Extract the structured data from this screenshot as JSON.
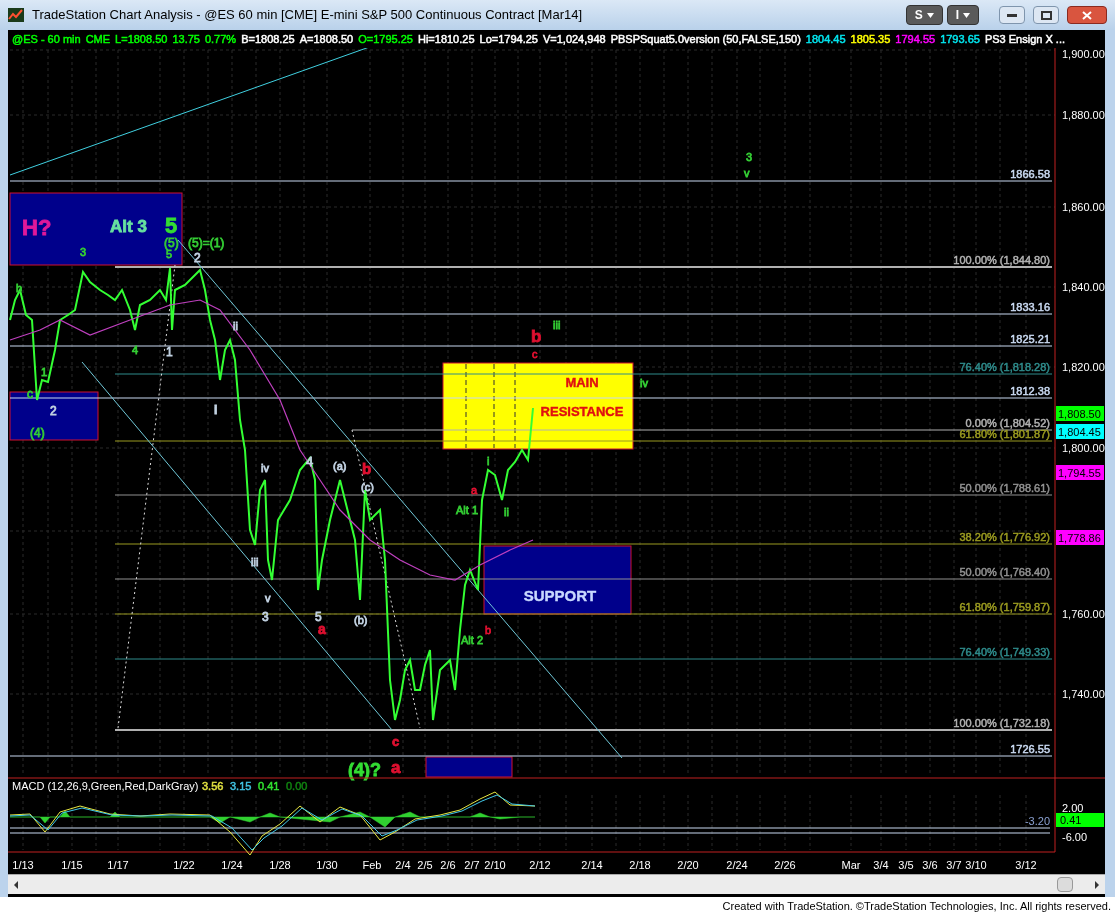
{
  "window": {
    "title": "TradeStation Chart Analysis - @ES 60 min [CME] E-mini S&P 500 Continuous Contract [Mar14]",
    "menu_buttons": [
      "S",
      "I"
    ]
  },
  "status_line": [
    {
      "text": "@ES - 60 min",
      "color": "#00ff00"
    },
    {
      "text": "CME",
      "color": "#00ff00"
    },
    {
      "text": "L=1808.50",
      "color": "#00ff00"
    },
    {
      "text": "13.75",
      "color": "#00ff00"
    },
    {
      "text": "0.77%",
      "color": "#00ff00"
    },
    {
      "text": "B=1808.25",
      "color": "#ffffff"
    },
    {
      "text": "A=1808.50",
      "color": "#ffffff"
    },
    {
      "text": "O=1795.25",
      "color": "#00ff00"
    },
    {
      "text": "Hi=1810.25",
      "color": "#ffffff"
    },
    {
      "text": "Lo=1794.25",
      "color": "#ffffff"
    },
    {
      "text": "V=1,024,948",
      "color": "#ffffff"
    },
    {
      "text": "PBSPSquat5.0version (50,FALSE,150)",
      "color": "#ffffff"
    },
    {
      "text": "1804.45",
      "color": "#00e5ee"
    },
    {
      "text": "1805.35",
      "color": "#ffff00"
    },
    {
      "text": "1794.55",
      "color": "#ff00ff"
    },
    {
      "text": "1793.65",
      "color": "#00e5ee"
    },
    {
      "text": "PS3 Ensign X ...",
      "color": "#ffffff"
    }
  ],
  "price_axis": [
    "1,900.00",
    "1,880.00",
    "1,860.00",
    "1,840.00",
    "1,820.00",
    "1,800.00",
    "1,760.00",
    "1,740.00"
  ],
  "price_markers": [
    {
      "text": "1,808.50",
      "color": "#00ff00"
    },
    {
      "text": "1,804.45",
      "color": "#00ffff"
    },
    {
      "text": "1,794.55",
      "color": "#ff00ff"
    },
    {
      "text": "1,778.86",
      "color": "#ff00ff"
    }
  ],
  "levels": [
    {
      "label": "1866.58",
      "color": "#c8d8f0"
    },
    {
      "label": "100.00% (1,844.80)",
      "color": "#b0b0b0"
    },
    {
      "label": "1833.16",
      "color": "#c8d8f0"
    },
    {
      "label": "1825.21",
      "color": "#c8d8f0"
    },
    {
      "label": "76.40% (1,818.28)",
      "color": "#2e8b8b"
    },
    {
      "label": "1812.38",
      "color": "#c8d8f0"
    },
    {
      "label": "0.00% (1,804.52)",
      "color": "#b0b0b0"
    },
    {
      "label": "61.80% (1,801.87)",
      "color": "#9a9a20"
    },
    {
      "label": "50.00% (1,788.61)",
      "color": "#909090"
    },
    {
      "label": "38.20% (1,776.92)",
      "color": "#9a9a20"
    },
    {
      "label": "50.00% (1,768.40)",
      "color": "#909090"
    },
    {
      "label": "61.80% (1,759.87)",
      "color": "#9a9a20"
    },
    {
      "label": "76.40% (1,749.33)",
      "color": "#2e8b8b"
    },
    {
      "label": "100.00% (1,732.18)",
      "color": "#b0b0b0"
    },
    {
      "label": "1726.55",
      "color": "#c8d8f0"
    }
  ],
  "zones": [
    {
      "color": "#00008b"
    },
    {
      "color": "#00008b"
    },
    {
      "color": "#ffff00",
      "texts": [
        "MAIN",
        "RESISTANCE"
      ]
    },
    {
      "color": "#00008b",
      "texts": [
        "SUPPORT"
      ]
    },
    {
      "color": "#00008b"
    }
  ],
  "wave_labels": [
    {
      "text": "H?",
      "color": "#e0189a"
    },
    {
      "text": "Alt 3",
      "color": "#66e0a0"
    },
    {
      "text": "5",
      "color": "#33dd33"
    },
    {
      "text": "(5)",
      "color": "#33cc33"
    },
    {
      "text": "5",
      "color": "#33cc33"
    },
    {
      "text": "(5)=(1)",
      "color": "#33cc33"
    },
    {
      "text": "3",
      "color": "#33cc33"
    },
    {
      "text": "2",
      "color": "#c0d0e0"
    },
    {
      "text": "b",
      "color": "#33cc33"
    },
    {
      "text": "4",
      "color": "#33cc33"
    },
    {
      "text": "1",
      "color": "#c0d0e0"
    },
    {
      "text": "ii",
      "color": "#c0d0e0"
    },
    {
      "text": "1",
      "color": "#33cc33"
    },
    {
      "text": "2",
      "color": "#c0d0e0"
    },
    {
      "text": "c",
      "color": "#33cc33"
    },
    {
      "text": "(4)",
      "color": "#33cc33"
    },
    {
      "text": "i",
      "color": "#c0d0e0"
    },
    {
      "text": "iv",
      "color": "#c0d0e0"
    },
    {
      "text": "4",
      "color": "#c0d0e0"
    },
    {
      "text": "(a)",
      "color": "#c0d0e0"
    },
    {
      "text": "b",
      "color": "#e01030"
    },
    {
      "text": "(c)",
      "color": "#c0d0e0"
    },
    {
      "text": "iii",
      "color": "#c0d0e0"
    },
    {
      "text": "v",
      "color": "#c0d0e0"
    },
    {
      "text": "3",
      "color": "#c0d0e0"
    },
    {
      "text": "5",
      "color": "#c0d0e0"
    },
    {
      "text": "a",
      "color": "#e01030"
    },
    {
      "text": "(b)",
      "color": "#c0d0e0"
    },
    {
      "text": "c",
      "color": "#e01030"
    },
    {
      "text": "(4)?",
      "color": "#33dd33"
    },
    {
      "text": "a",
      "color": "#e01030"
    },
    {
      "text": "a",
      "color": "#e01030"
    },
    {
      "text": "Alt 1",
      "color": "#33cc33"
    },
    {
      "text": "i",
      "color": "#33cc33"
    },
    {
      "text": "ii",
      "color": "#33cc33"
    },
    {
      "text": "Alt 2",
      "color": "#33cc33"
    },
    {
      "text": "b",
      "color": "#e01030"
    },
    {
      "text": "b",
      "color": "#e01030"
    },
    {
      "text": "c",
      "color": "#e01030"
    },
    {
      "text": "iii",
      "color": "#33cc33"
    },
    {
      "text": "iv",
      "color": "#33cc33"
    },
    {
      "text": "3",
      "color": "#33cc33"
    },
    {
      "text": "v",
      "color": "#33cc33"
    }
  ],
  "macd": {
    "label": "MACD (12,26,9,Green,Red,DarkGray)",
    "values": [
      {
        "text": "3.56",
        "color": "#e0e040"
      },
      {
        "text": "3.15",
        "color": "#40c0e0"
      },
      {
        "text": "0.41",
        "color": "#30e030"
      },
      {
        "text": "0.00",
        "color": "#108010"
      }
    ],
    "axis": [
      "2.00",
      "-6.00"
    ],
    "marker": "0.41",
    "level": "-3.20"
  },
  "date_axis": [
    "1/13",
    "1/15",
    "1/17",
    "1/22",
    "1/24",
    "1/28",
    "1/30",
    "Feb",
    "2/4",
    "2/5",
    "2/6",
    "2/7",
    "2/10",
    "2/12",
    "2/14",
    "2/18",
    "2/20",
    "2/24",
    "2/26",
    "Mar",
    "3/4",
    "3/5",
    "3/6",
    "3/7",
    "3/10",
    "3/12"
  ],
  "footer": "Created with TradeStation. ©TradeStation Technologies, Inc. All rights reserved."
}
